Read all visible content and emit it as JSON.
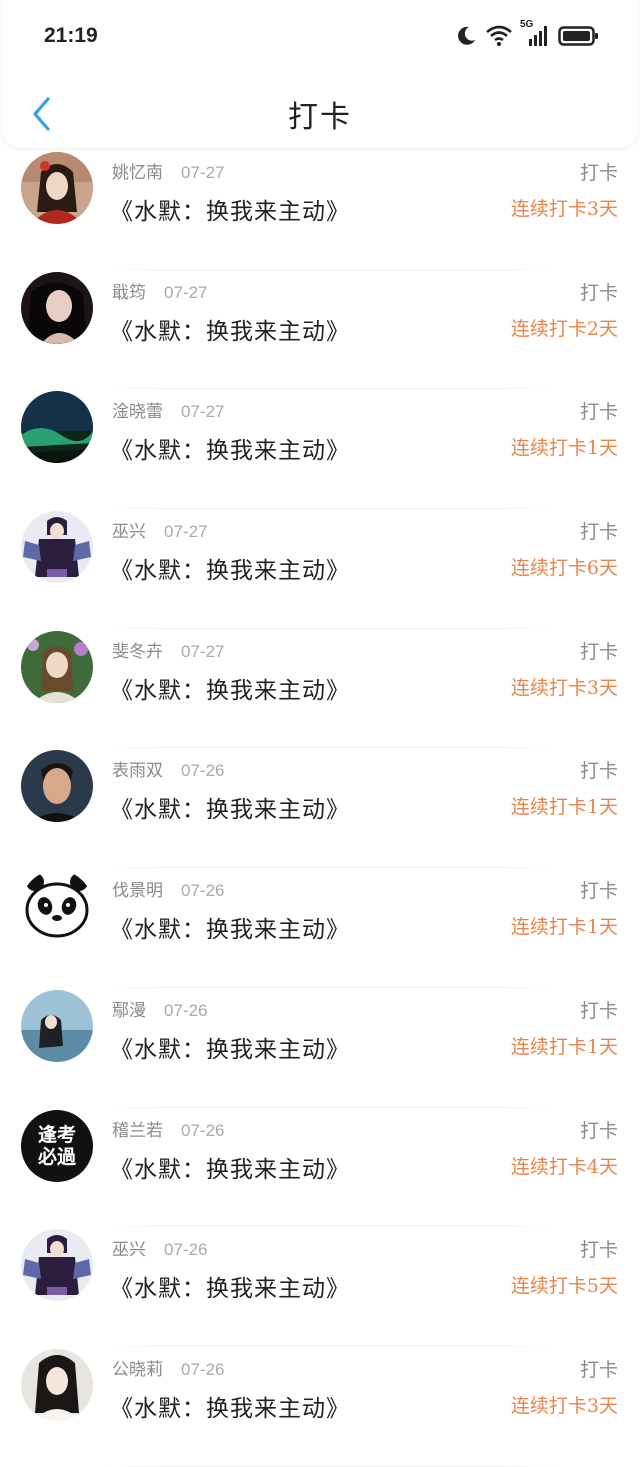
{
  "status_bar": {
    "time": "21:19",
    "network_label": "5G",
    "icons": [
      "moon-icon",
      "wifi-icon",
      "signal-icon",
      "battery-icon"
    ]
  },
  "header": {
    "title": "打卡",
    "back_icon": "chevron-left-icon",
    "accent_color": "#3a9fe0"
  },
  "colors": {
    "streak": "#e8854a",
    "muted": "#8a8a8a"
  },
  "items": [
    {
      "name": "姚忆南",
      "date": "07-27",
      "book": "《水默：换我来主动》",
      "action": "打卡",
      "streak": "连续打卡3天",
      "avatar": "avatar-woman-red"
    },
    {
      "name": "戢筠",
      "date": "07-27",
      "book": "《水默：换我来主动》",
      "action": "打卡",
      "streak": "连续打卡2天",
      "avatar": "avatar-woman-dark"
    },
    {
      "name": "淦晓蕾",
      "date": "07-27",
      "book": "《水默：换我来主动》",
      "action": "打卡",
      "streak": "连续打卡1天",
      "avatar": "avatar-aurora"
    },
    {
      "name": "巫兴",
      "date": "07-27",
      "book": "《水默：换我来主动》",
      "action": "打卡",
      "streak": "连续打卡6天",
      "avatar": "avatar-anime-man"
    },
    {
      "name": "斐冬卉",
      "date": "07-27",
      "book": "《水默：换我来主动》",
      "action": "打卡",
      "streak": "连续打卡3天",
      "avatar": "avatar-woman-flowers"
    },
    {
      "name": "表雨双",
      "date": "07-26",
      "book": "《水默：换我来主动》",
      "action": "打卡",
      "streak": "连续打卡1天",
      "avatar": "avatar-man-portrait"
    },
    {
      "name": "伐景明",
      "date": "07-26",
      "book": "《水默：换我来主动》",
      "action": "打卡",
      "streak": "连续打卡1天",
      "avatar": "avatar-panda"
    },
    {
      "name": "鄢漫",
      "date": "07-26",
      "book": "《水默：换我来主动》",
      "action": "打卡",
      "streak": "连续打卡1天",
      "avatar": "avatar-seaside"
    },
    {
      "name": "稽兰若",
      "date": "07-26",
      "book": "《水默：换我来主动》",
      "action": "打卡",
      "streak": "连续打卡4天",
      "avatar": "avatar-text-logo",
      "avatar_text": [
        "逢考",
        "必過"
      ]
    },
    {
      "name": "巫兴",
      "date": "07-26",
      "book": "《水默：换我来主动》",
      "action": "打卡",
      "streak": "连续打卡5天",
      "avatar": "avatar-anime-man"
    },
    {
      "name": "公晓莉",
      "date": "07-26",
      "book": "《水默：换我来主动》",
      "action": "打卡",
      "streak": "连续打卡3天",
      "avatar": "avatar-woman-bw"
    }
  ]
}
